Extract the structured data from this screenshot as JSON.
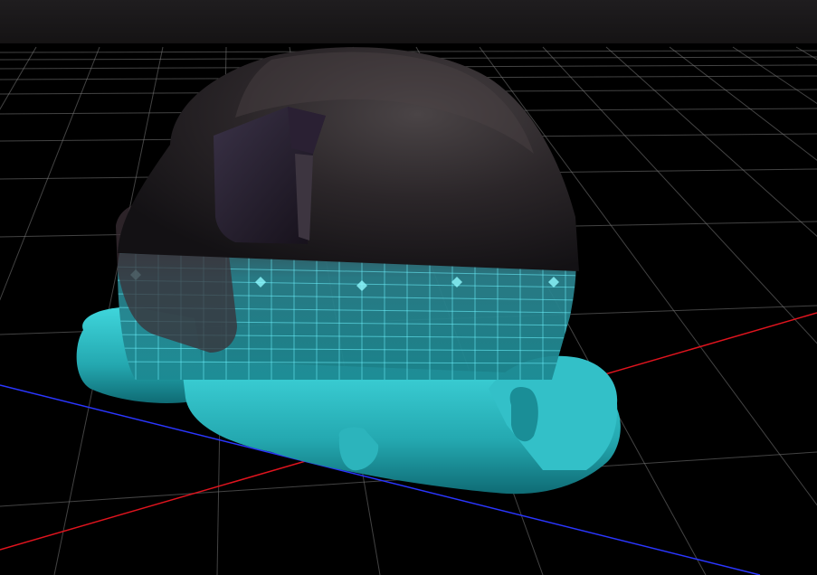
{
  "viewport": {
    "background_color": "#000000",
    "top_band_color": "#1d1b1d",
    "grid_color": "#8a8a8a",
    "x_axis_color": "#e0141e",
    "z_axis_color": "#2a36ff"
  },
  "model": {
    "shell_color": "#2a2528",
    "base_color": "#36c8d0",
    "wireframe_color": "#6ef4ff",
    "icon": "3d-model-icon"
  }
}
